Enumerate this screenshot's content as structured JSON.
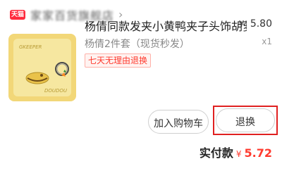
{
  "store": {
    "badge_text": "天猫",
    "name": "家家百货旗舰店",
    "chevron": "›"
  },
  "product": {
    "thumb_tag": "GKEEPER",
    "thumb_tag2": "DOUDOU",
    "title": "杨倩同款发夹小黄鸭夹子头饰胡萝卜",
    "variant": "杨倩2件套（现货秒发）",
    "return_badge": "七天无理由退换",
    "currency": "¥",
    "price": "5.80",
    "qty": "x1"
  },
  "actions": {
    "add_to_cart": "加入购物车",
    "return": "退换"
  },
  "total": {
    "label": "实付款",
    "currency": "¥",
    "value": "5.72"
  },
  "colors": {
    "accent_red": "#ff3b2f",
    "tmall_red": "#ff2a3d",
    "highlight_red": "#e02020"
  }
}
